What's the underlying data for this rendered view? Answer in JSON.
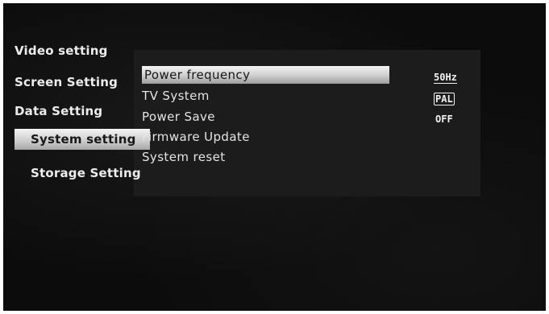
{
  "menu": {
    "items": [
      {
        "label": "Video setting"
      },
      {
        "label": "Screen Setting"
      },
      {
        "label": "Data Setting"
      },
      {
        "label": "System setting"
      },
      {
        "label": "Storage Setting"
      }
    ],
    "selected_index": 3
  },
  "submenu": {
    "items": [
      {
        "label": "Power frequency",
        "value": "50Hz"
      },
      {
        "label": "TV System",
        "value": "PAL"
      },
      {
        "label": "Power Save",
        "value": "OFF"
      },
      {
        "label": "Firmware Update"
      },
      {
        "label": "System reset"
      }
    ],
    "selected_index": 0
  },
  "colors": {
    "background": "#0c0c0c",
    "panel": "#1c1c1c",
    "highlight": "#cfcfcf",
    "text": "#ececec"
  }
}
